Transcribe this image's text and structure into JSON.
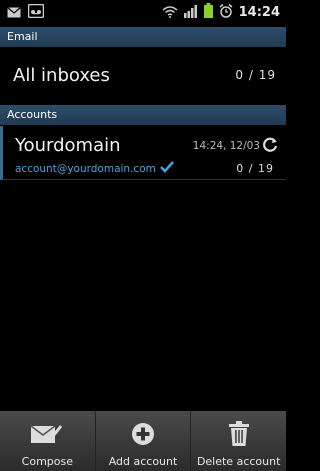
{
  "status_bar": {
    "time": "14:24",
    "icons": [
      "mail-icon",
      "voicemail-icon",
      "wifi-icon",
      "signal-icon",
      "battery-icon",
      "alarm-icon"
    ]
  },
  "sections": {
    "email_header": "Email",
    "accounts_header": "Accounts"
  },
  "all_inboxes": {
    "label": "All inboxes",
    "count": "0 / 19"
  },
  "account": {
    "name": "Yourdomain",
    "email": "account@yourdomain.com",
    "timestamp": "14:24, 12/03",
    "count": "0 / 19"
  },
  "bottom_bar": {
    "compose": "Compose",
    "add_account": "Add account",
    "delete_account": "Delete account"
  },
  "colors": {
    "header_bg": "#2c4e6a",
    "email_link": "#4aa3df",
    "battery": "#8ccf2c"
  }
}
